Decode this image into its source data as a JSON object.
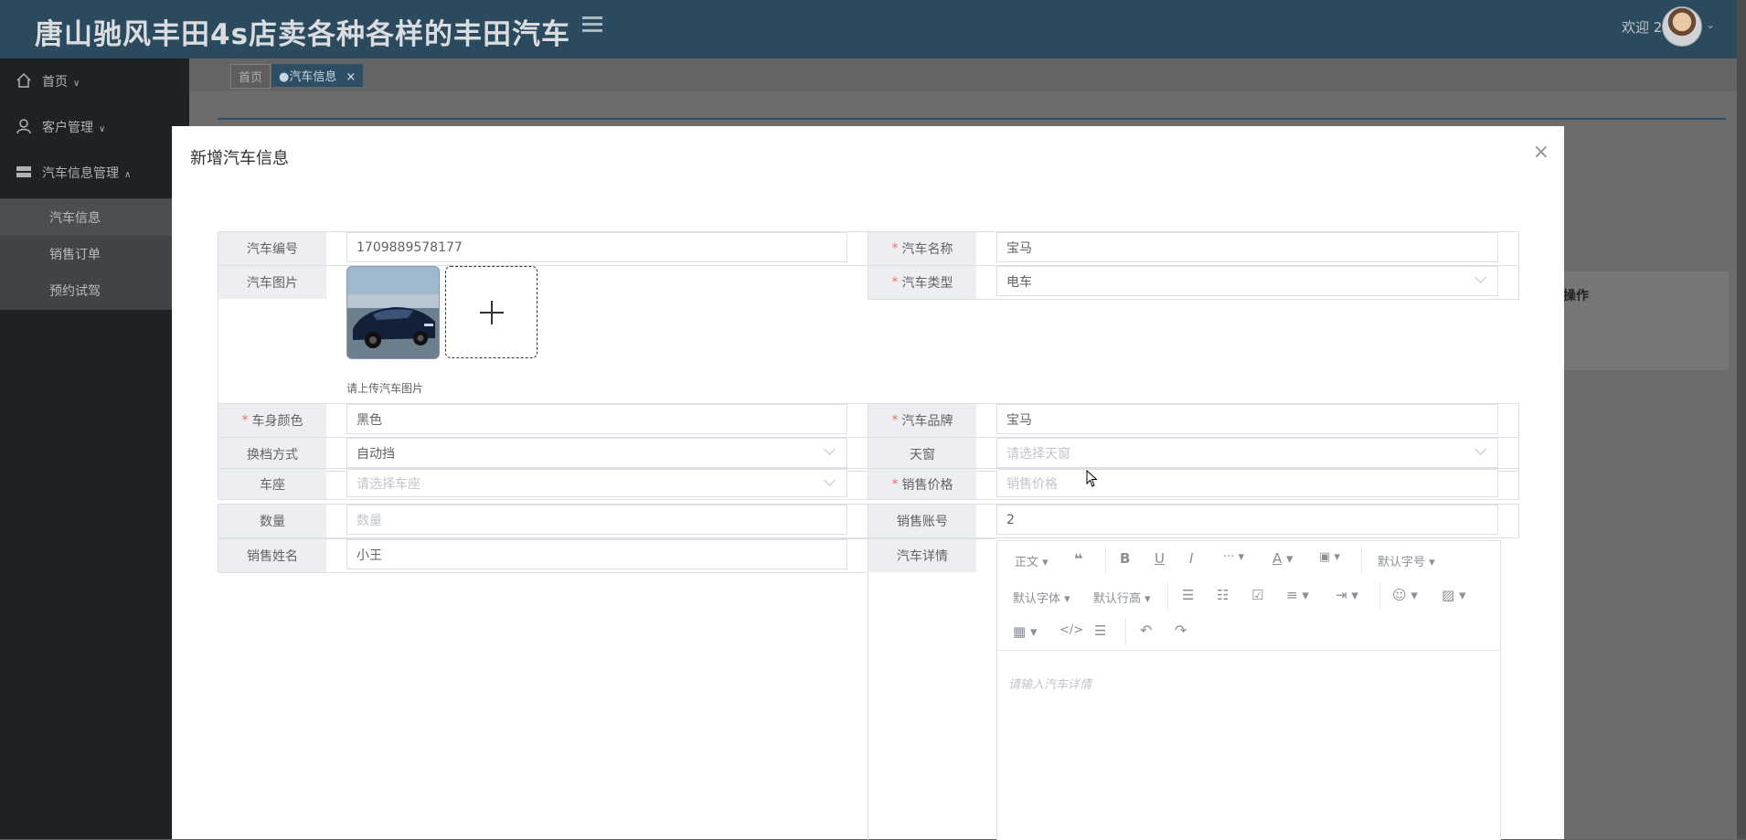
{
  "app": {
    "title": "唐山驰风丰田4s店卖各种各样的丰田汽车",
    "welcome": "欢迎 2"
  },
  "sidebar": {
    "items": [
      {
        "label": "首页",
        "icon": "home-icon"
      },
      {
        "label": "客户管理",
        "icon": "user-icon"
      },
      {
        "label": "汽车信息管理",
        "icon": "server-icon"
      }
    ],
    "subitems": [
      "汽车信息",
      "销售订单",
      "预约试驾"
    ]
  },
  "tabs": {
    "home": "首页",
    "active": "●汽车信息"
  },
  "background": {
    "operation_header": "操作"
  },
  "modal": {
    "title": "新增汽车信息",
    "close": "×",
    "fields": {
      "car_no": {
        "label": "汽车编号",
        "value": "1709889578177"
      },
      "car_name": {
        "label": "汽车名称",
        "value": "宝马"
      },
      "car_image": {
        "label": "汽车图片",
        "tip": "请上传汽车图片"
      },
      "car_type": {
        "label": "汽车类型",
        "value": "电车"
      },
      "body_color": {
        "label": "车身颜色",
        "value": "黑色"
      },
      "brand": {
        "label": "汽车品牌",
        "value": "宝马"
      },
      "transmission": {
        "label": "换档方式",
        "value": "自动挡"
      },
      "sunroof": {
        "label": "天窗",
        "placeholder": "请选择天窗"
      },
      "seat": {
        "label": "车座",
        "placeholder": "请选择车座"
      },
      "price": {
        "label": "销售价格",
        "placeholder": "销售价格"
      },
      "quantity": {
        "label": "数量",
        "placeholder": "数量"
      },
      "sales_account": {
        "label": "销售账号",
        "value": "2"
      },
      "sales_name": {
        "label": "销售姓名",
        "value": "小王"
      },
      "details": {
        "label": "汽车详情",
        "placeholder": "请输入汽车详情"
      }
    },
    "editor_toolbar": {
      "paragraph": "正文",
      "font_size": "默认字号",
      "font_family": "默认字体",
      "line_height": "默认行高"
    }
  },
  "colors": {
    "header": "#2b4a5e",
    "sidebar": "#1c2226",
    "required": "#f56c6c",
    "label_bg": "#eceef1"
  }
}
